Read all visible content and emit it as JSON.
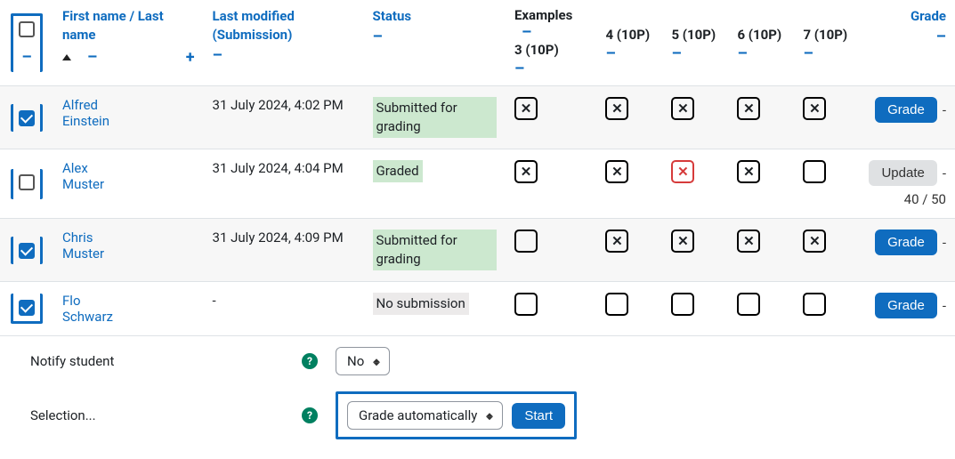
{
  "headers": {
    "first_name": "First name",
    "name_separator": "/",
    "last_name": "Last name",
    "last_modified_l1": "Last modified",
    "last_modified_l2": "(Submission)",
    "status": "Status",
    "examples": "Examples",
    "grade": "Grade",
    "minus": "–",
    "plus": "+"
  },
  "example_columns": [
    {
      "label": "3 (10P)"
    },
    {
      "label": "4 (10P)"
    },
    {
      "label": "5 (10P)"
    },
    {
      "label": "6 (10P)"
    },
    {
      "label": "7 (10P)"
    }
  ],
  "rows": [
    {
      "checked": true,
      "alt": true,
      "first": "Alfred",
      "last": "Einstein",
      "modified": "31 July 2024, 4:02 PM",
      "status_text": "Submitted for grading",
      "status_class": "green",
      "examples": [
        "x",
        "x",
        "x",
        "x",
        "x"
      ],
      "grade_btn": "Grade",
      "grade_btn_style": "primary",
      "sub_grade": ""
    },
    {
      "checked": false,
      "alt": false,
      "first": "Alex",
      "last": "Muster",
      "modified": "31 July 2024, 4:04 PM",
      "status_text": "Graded",
      "status_class": "green",
      "examples": [
        "x",
        "x",
        "xr",
        "x",
        "o"
      ],
      "grade_btn": "Update",
      "grade_btn_style": "secondary",
      "sub_grade": "40 / 50"
    },
    {
      "checked": true,
      "alt": true,
      "first": "Chris",
      "last": "Muster",
      "modified": "31 July 2024, 4:09 PM",
      "status_text": "Submitted for grading",
      "status_class": "green",
      "examples": [
        "o",
        "x",
        "x",
        "x",
        "x"
      ],
      "grade_btn": "Grade",
      "grade_btn_style": "primary",
      "sub_grade": ""
    },
    {
      "checked": true,
      "alt": false,
      "first": "Flo",
      "last": "Schwarz",
      "modified": "-",
      "status_text": "No submission",
      "status_class": "grey",
      "examples": [
        "o",
        "o",
        "o",
        "o",
        "o"
      ],
      "grade_btn": "Grade",
      "grade_btn_style": "primary",
      "sub_grade": ""
    }
  ],
  "footer": {
    "notify_label": "Notify student",
    "notify_value": "No",
    "selection_label": "Selection...",
    "selection_value": "Grade automatically",
    "start_label": "Start"
  }
}
